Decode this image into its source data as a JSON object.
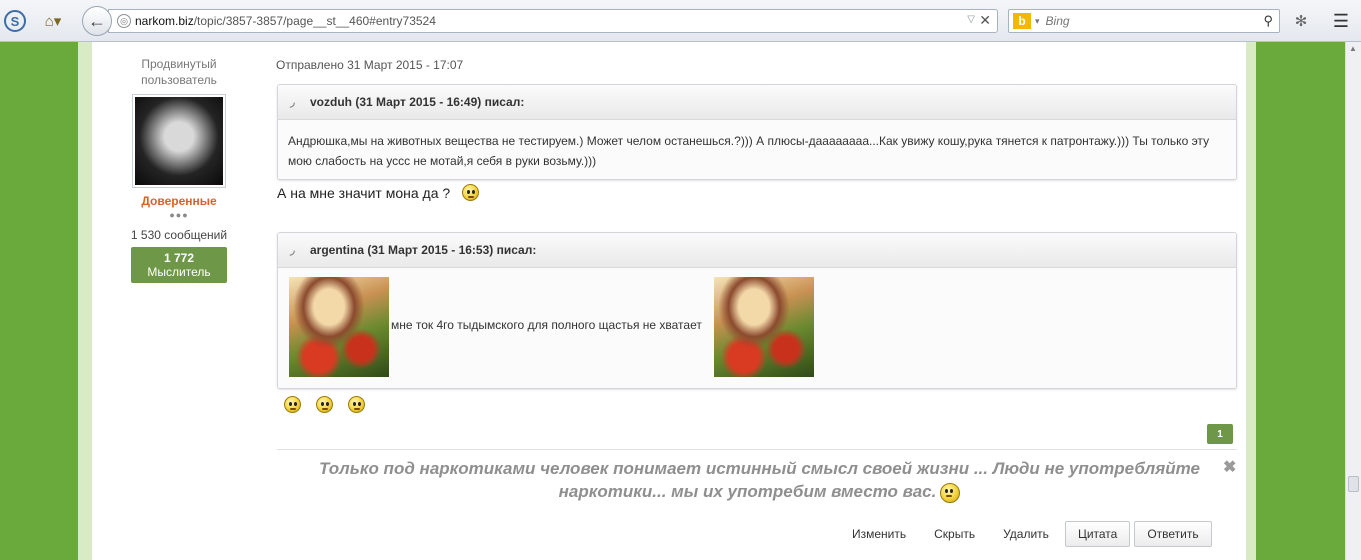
{
  "browser": {
    "url_host": "narkom.biz",
    "url_path": "/topic/3857-3857/page__st__460#entry73524",
    "search_placeholder": "Bing",
    "search_engine_logo": "b",
    "icons": [
      "s-icon",
      "home-icon",
      "back-arrow-icon",
      "globe-icon",
      "dropdown-icon",
      "close-icon",
      "bing-icon",
      "search-icon",
      "addon-icon",
      "menu-icon"
    ]
  },
  "author": {
    "title": "Продвинутый пользователь",
    "group": "Доверенные",
    "pips": "●●●",
    "post_count": "1 530 сообщений",
    "reputation_value": "1 772",
    "reputation_label": "Мыслитель",
    "group_color": "#d9622b"
  },
  "post": {
    "date": "Отправлено 31 Март 2015 - 17:07",
    "quote1": {
      "header": "vozduh (31 Март 2015 - 16:49) писал:",
      "body": "Андрюшка,мы на животных вещества не тестируем.) Может челом останешься.?))) А плюсы-даааааааа...Как увижу кошу,рука тянется к патронтажу.))) Ты только эту мою слабость на уссс не мотай,я себя в руки возьму.)))"
    },
    "reply_text": "А на мне значит мона да ?",
    "quote2": {
      "header": "argentina (31 Март 2015 - 16:53) писал:",
      "caption": "мне ток 4го тыдымского для полного щастья не хватает"
    },
    "page_number": "1",
    "signature": "Только под наркотиками человек понимает истинный смысл своей жизни ... Люди не употребляйте наркотики... мы их употребим вместо вас.",
    "signature_close": "✖"
  },
  "actions": {
    "edit": "Изменить",
    "hide": "Скрыть",
    "delete": "Удалить",
    "quote": "Цитата",
    "reply": "Ответить"
  },
  "colors": {
    "page_green": "#6aaa3c",
    "badge_green": "#6f9748"
  }
}
